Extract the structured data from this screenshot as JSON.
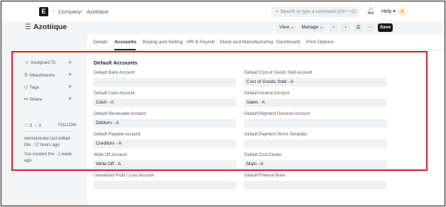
{
  "navbar": {
    "logo": "E",
    "breadcrumbs": [
      "Company",
      "Azotiique"
    ],
    "search_placeholder": "Search or type a command (Ctrl + G)",
    "help_label": "Help",
    "avatar_initial": "A"
  },
  "header": {
    "title": "Azotiique",
    "view_label": "View",
    "manage_label": "Manage",
    "save_label": "Save"
  },
  "tabs": [
    "Details",
    "Accounts",
    "Buying and Selling",
    "HR & Payroll",
    "Stock and Manufacturing",
    "Dashboard",
    "Print Options"
  ],
  "sidebar": {
    "items": [
      {
        "label": "Assigned To",
        "icon": "user-assign-icon"
      },
      {
        "label": "Attachments",
        "icon": "paperclip-icon"
      },
      {
        "label": "Tags",
        "icon": "tag-icon"
      },
      {
        "label": "Share",
        "icon": "share-icon"
      }
    ],
    "likes": "0",
    "comments": "0",
    "follow_label": "FOLLOW",
    "activity": [
      "Administrator last edited this · 17 hours ago",
      "You created this · 1 week ago"
    ]
  },
  "section": {
    "title": "Default Accounts",
    "left_fields": [
      {
        "label": "Default Bank Account",
        "value": ""
      },
      {
        "label": "Default Cash Account",
        "value": "Cash - A"
      },
      {
        "label": "Default Receivable Account",
        "value": "Debtors - A"
      },
      {
        "label": "Default Payable Account",
        "value": "Creditors - A"
      },
      {
        "label": "Write Off Account",
        "value": "Write Off - A"
      },
      {
        "label": "Unrealized Profit / Loss Account",
        "value": ""
      }
    ],
    "right_fields": [
      {
        "label": "Default Cost of Goods Sold Account",
        "value": "Cost of Goods Sold - A"
      },
      {
        "label": "Default Income Account",
        "value": "Sales - A"
      },
      {
        "label": "Default Payment Discount Account",
        "value": ""
      },
      {
        "label": "Default Payment Terms Template",
        "value": ""
      },
      {
        "label": "Default Cost Center",
        "value": "Main - A"
      },
      {
        "label": "Default Finance Book",
        "value": ""
      }
    ]
  },
  "colors": {
    "highlight": "#d8202a",
    "primary_button": "#171717"
  }
}
